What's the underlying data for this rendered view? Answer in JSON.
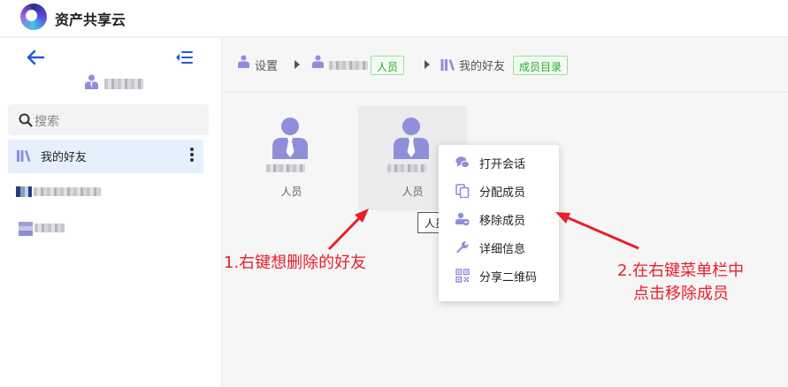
{
  "app": {
    "title": "资产共享云"
  },
  "sidebar": {
    "search_placeholder": "搜索",
    "active_item": {
      "label": "我的好友"
    }
  },
  "breadcrumb": {
    "settings": "设置",
    "member_tag": "人员",
    "friends": "我的好友",
    "catalog_tag": "成员目录"
  },
  "tiles": [
    {
      "role": "人员"
    },
    {
      "role": "人员"
    }
  ],
  "tooltip": "人员",
  "context_menu": {
    "items": [
      {
        "label": "打开会话",
        "icon": "chat-icon"
      },
      {
        "label": "分配成员",
        "icon": "copy-icon"
      },
      {
        "label": "移除成员",
        "icon": "remove-user-icon"
      },
      {
        "label": "详细信息",
        "icon": "wrench-icon"
      },
      {
        "label": "分享二维码",
        "icon": "qr-code-icon"
      }
    ]
  },
  "annotations": {
    "step1": "1.右键想删除的好友",
    "step2_line1": "2.在右键菜单栏中",
    "step2_line2": "点击移除成员"
  },
  "colors": {
    "accent": "#1e5bd8",
    "icon_purple": "#8f8fd9",
    "annotation_red": "#e8202a",
    "tag_green": "#2dab2d"
  }
}
